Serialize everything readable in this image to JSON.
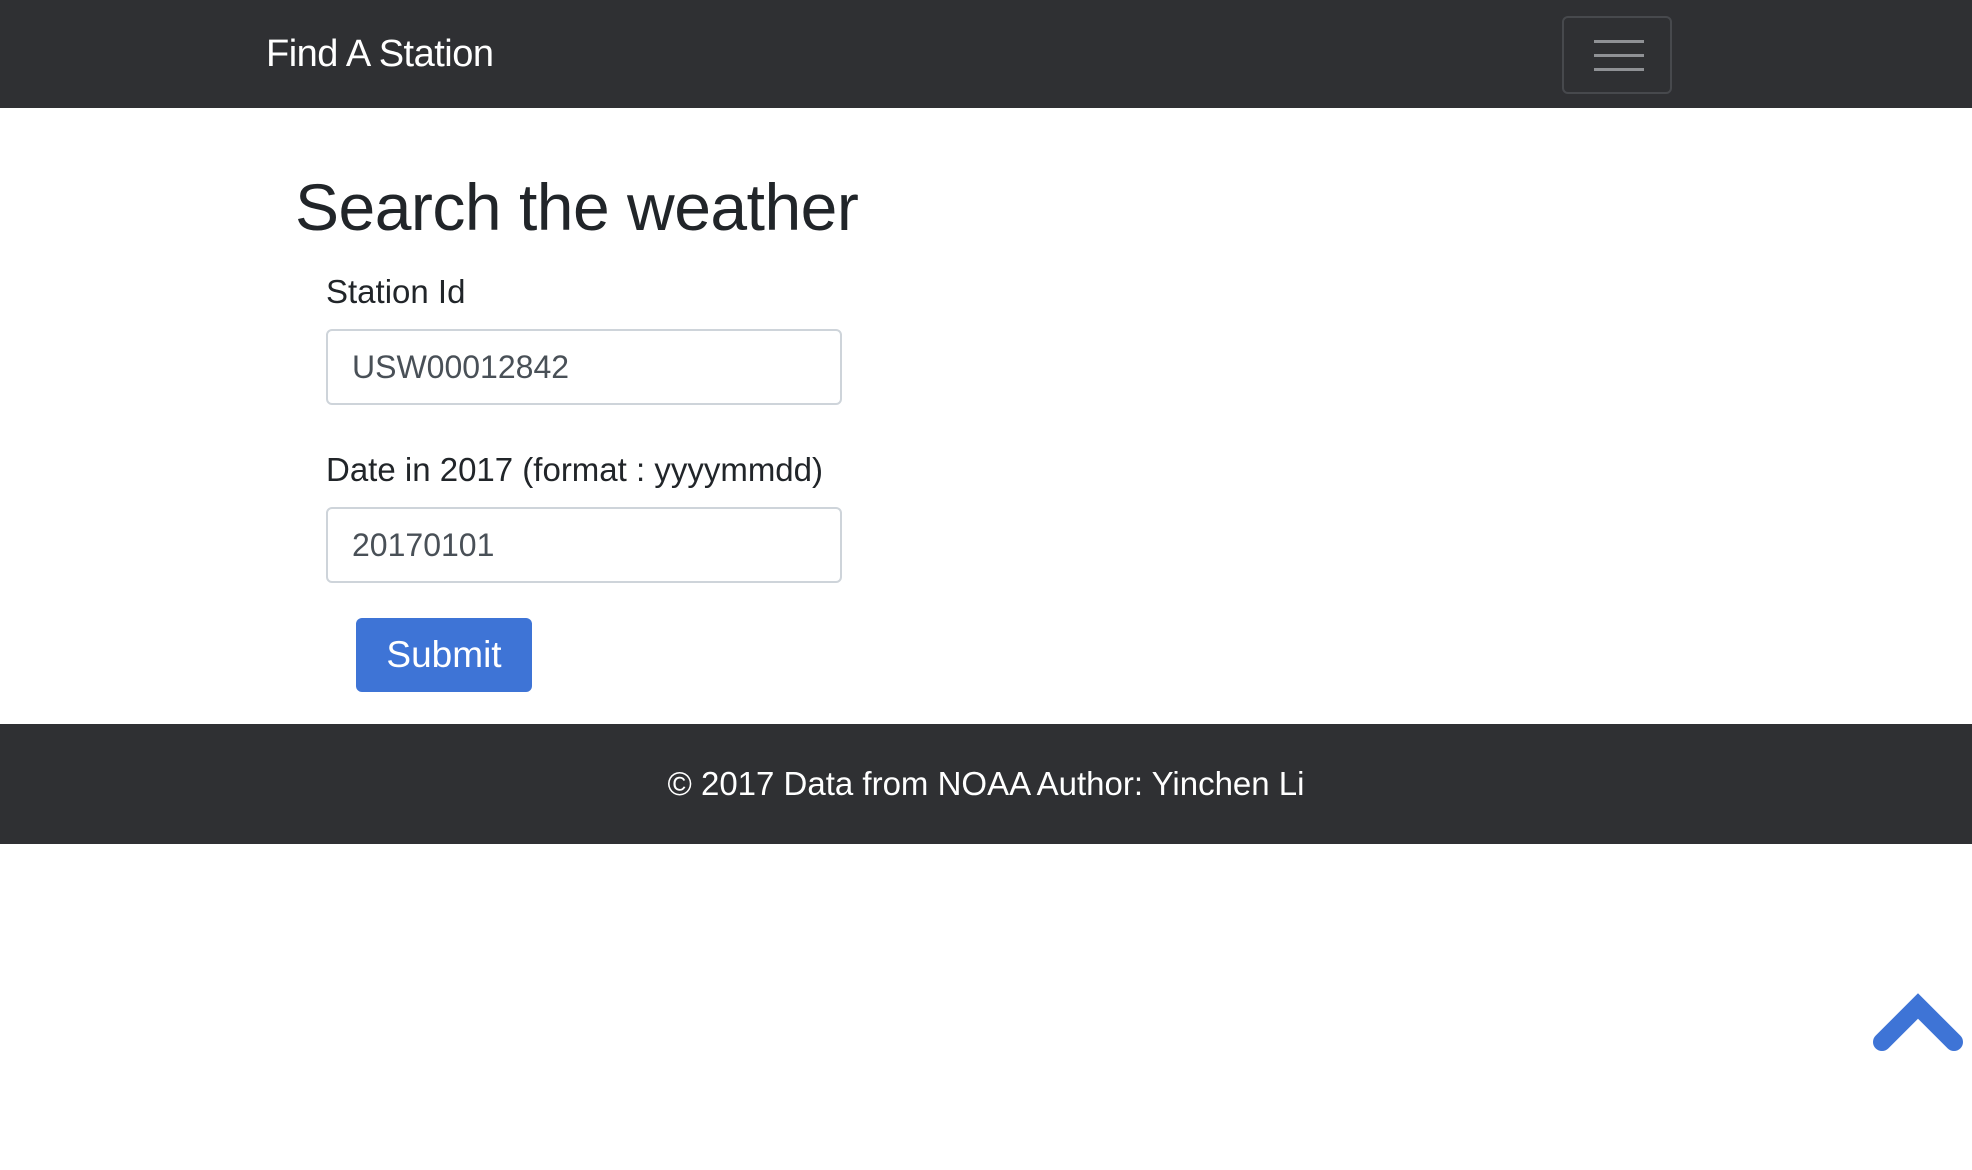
{
  "navbar": {
    "brand": "Find A Station",
    "toggle_icon": "hamburger-menu-icon",
    "background": "#2f3033"
  },
  "main": {
    "title": "Search the weather",
    "station_field": {
      "label": "Station Id",
      "value": "USW00012842"
    },
    "date_field": {
      "label": "Date in 2017 (format : yyyymmdd)",
      "value": "20170101"
    },
    "submit_label": "Submit",
    "accent": "#3e74d6"
  },
  "footer": {
    "text": "© 2017 Data from NOAA Author: Yinchen Li"
  },
  "scroll_top": {
    "icon": "chevron-up-icon",
    "color": "#3e74d6"
  }
}
